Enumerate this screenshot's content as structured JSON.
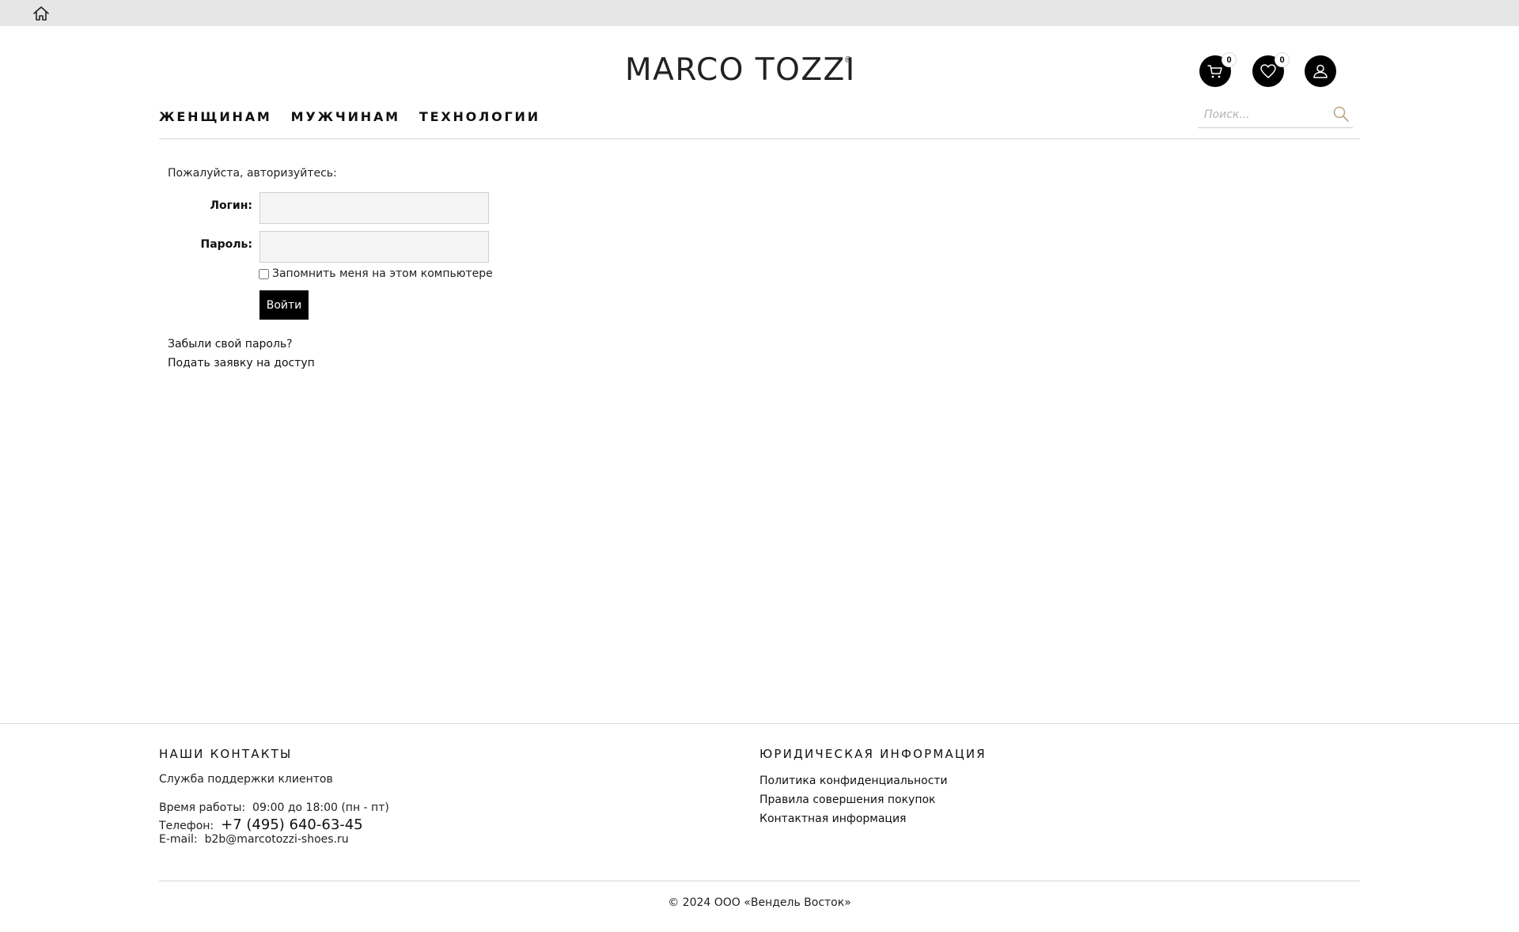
{
  "topbar": {
    "home_icon": "home-icon"
  },
  "header": {
    "logo_text": "MARCO TOZZI",
    "logo_mark": "®",
    "cart": {
      "icon": "cart-icon",
      "count": "0"
    },
    "wishlist": {
      "icon": "heart-icon",
      "count": "0"
    },
    "account": {
      "icon": "user-icon"
    },
    "nav": [
      "ЖЕНЩИНАМ",
      "МУЖЧИНАМ",
      "ТЕХНОЛОГИИ"
    ],
    "search": {
      "placeholder": "Поиск...",
      "value": "",
      "icon": "search-icon"
    }
  },
  "login": {
    "prompt": "Пожалуйста, авторизуйтесь:",
    "login_label": "Логин:",
    "login_value": "",
    "password_label": "Пароль:",
    "password_value": "",
    "remember_label": "Запомнить меня на этом компьютере",
    "submit_label": "Войти",
    "forgot_link": "Забыли свой пароль?",
    "request_link": "Подать заявку на доступ"
  },
  "footer": {
    "contacts_title": "НАШИ КОНТАКТЫ",
    "support": "Служба поддержки клиентов",
    "hours_label": "Время работы:",
    "hours_value": "09:00 до 18:00 (пн - пт)",
    "phone_label": "Телефон:",
    "phone_value": "+7 (495) 640-63-45",
    "email_label": "E-mail:",
    "email_value": "b2b@marcotozzi-shoes.ru",
    "legal_title": "ЮРИДИЧЕСКАЯ ИНФОРМАЦИЯ",
    "legal_links": [
      "Политика конфиденциальности",
      "Правила совершения покупок",
      "Контактная информация"
    ],
    "copyright": "© 2024 ООО «Вендель Восток»"
  },
  "colors": {
    "accent": "#000000",
    "topbar": "#e6e6e6",
    "search_icon": "#b8a47a"
  }
}
